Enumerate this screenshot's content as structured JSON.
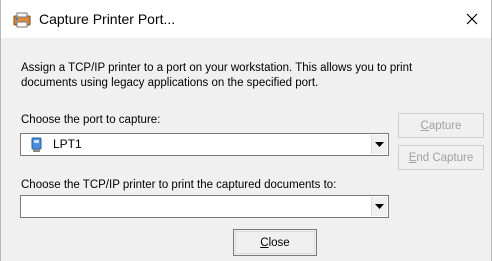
{
  "window": {
    "title": "Capture Printer Port...",
    "icon": "printer-port-icon",
    "close_glyph": "✕"
  },
  "description": "Assign a TCP/IP printer to a port on your workstation.  This allows you to print\ndocuments using legacy applications on the specified port.",
  "port": {
    "label": "Choose the port to capture:",
    "selected": "LPT1",
    "icon": "port-icon"
  },
  "printer": {
    "label": "Choose the TCP/IP printer to print the captured documents to:",
    "selected": ""
  },
  "buttons": {
    "capture": {
      "mnemonic": "C",
      "rest": "apture",
      "enabled": false
    },
    "end_capture": {
      "mnemonic": "E",
      "rest": "nd Capture",
      "enabled": false
    },
    "close": {
      "mnemonic": "C",
      "rest": "lose",
      "enabled": true
    }
  },
  "colors": {
    "dialog_bg": "#f0f0f0",
    "titlebar_bg": "#ffffff",
    "disabled_text": "#a0a0a0"
  }
}
